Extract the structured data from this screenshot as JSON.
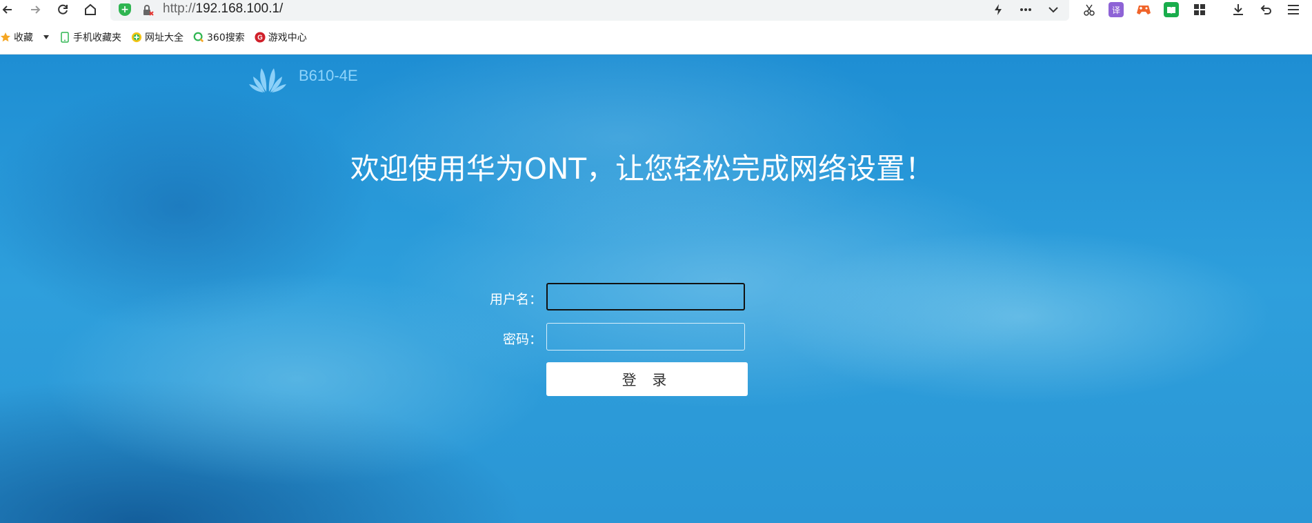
{
  "browser": {
    "url": "http://192.168.100.1/",
    "url_prefix": "http://",
    "url_host": "192.168.100.1/"
  },
  "bookmarks": [
    {
      "label": "收藏",
      "icon": "star-icon"
    },
    {
      "label": "手机收藏夹",
      "icon": "phone-icon"
    },
    {
      "label": "网址大全",
      "icon": "site-nav-icon"
    },
    {
      "label": "360搜索",
      "icon": "search-360-icon"
    },
    {
      "label": "游戏中心",
      "icon": "game-center-icon"
    }
  ],
  "page": {
    "model": "B610-4E",
    "welcome": "欢迎使用华为ONT，让您轻松完成网络设置！",
    "username_label": "用户名：",
    "password_label": "密码：",
    "username_value": "",
    "password_value": "",
    "login_label": "登 录"
  },
  "colors": {
    "page_bg": "#2a96d5",
    "model_text": "#8fd4fb",
    "shield": "#2fb551"
  }
}
